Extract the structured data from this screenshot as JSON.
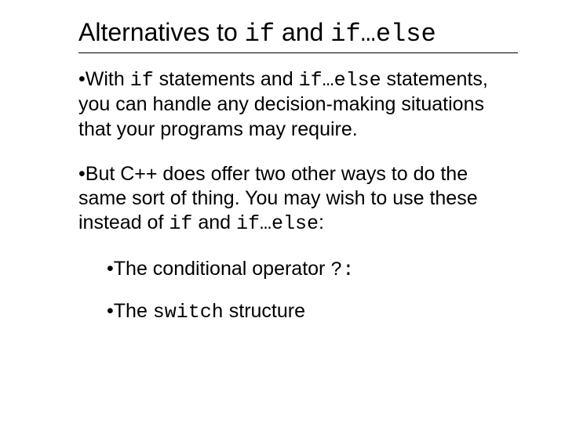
{
  "title": {
    "t1": "Alternatives to ",
    "c1": "if",
    "t2": " and ",
    "c2": "if…else"
  },
  "p1": {
    "a": "With ",
    "b": "if",
    "c": " statements and ",
    "d": "if…else",
    "e": " statements, you can handle any decision-making situations that your programs may require."
  },
  "p2": {
    "a": "But C++ does offer two other ways to do the same sort of thing.  You may wish to use these instead of ",
    "b": "if",
    "c": " and ",
    "d": "if…else",
    "e": ":"
  },
  "s1": {
    "a": "The conditional operator ",
    "b": "?:"
  },
  "s2": {
    "a": "The ",
    "b": "switch",
    "c": "  structure"
  },
  "bullet": "•"
}
